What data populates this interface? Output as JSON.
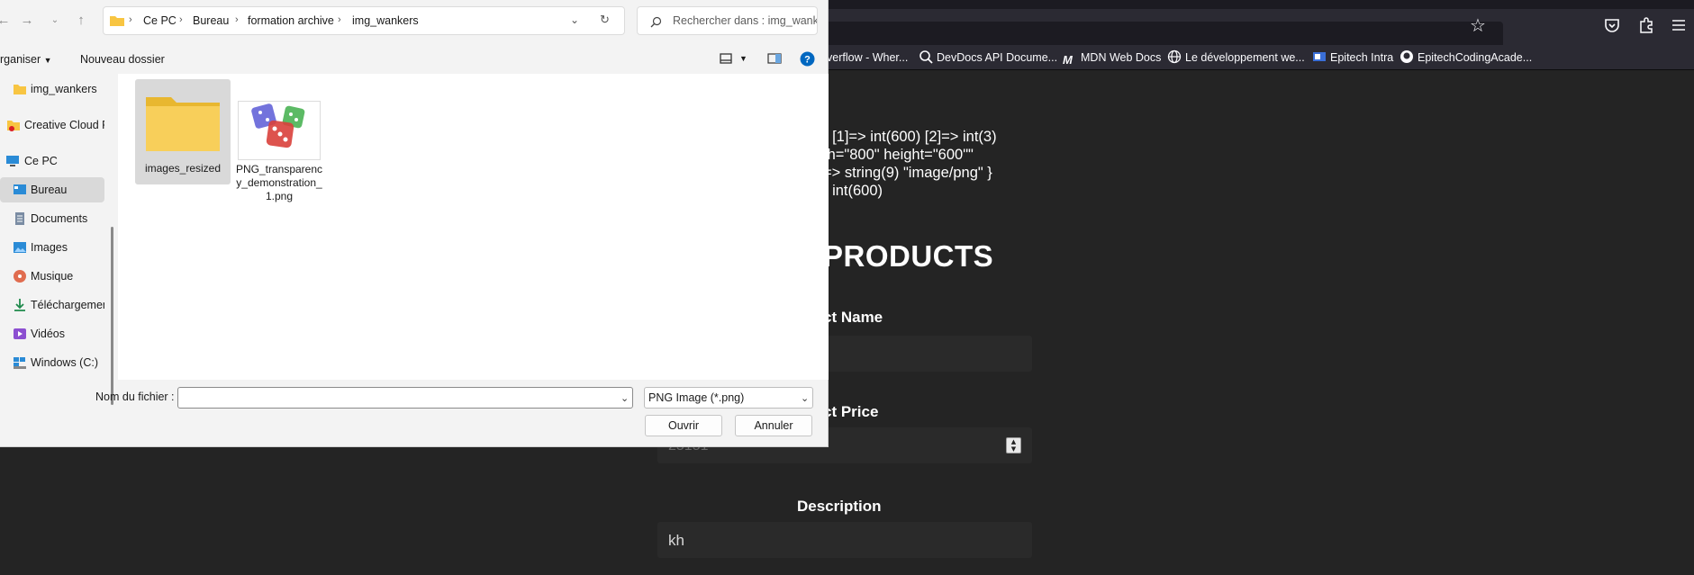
{
  "browser": {
    "bookmarks": [
      {
        "label": "verflow - Wher...",
        "icon": "stackoverflow-icon"
      },
      {
        "label": "DevDocs API Docume...",
        "icon": "devdocs-icon"
      },
      {
        "label": "MDN Web Docs",
        "icon": "mdn-icon"
      },
      {
        "label": "Le développement we...",
        "icon": "globe-icon"
      },
      {
        "label": "Epitech Intra",
        "icon": "epitech-icon"
      },
      {
        "label": "EpitechCodingAcade...",
        "icon": "github-icon"
      }
    ]
  },
  "page": {
    "dump_lines": [
      ") [1]=> int(600) [2]=> int(3)",
      "th=\"800\" height=\"600\"\"",
      "=> string(9) \"image/png\" }",
      ") int(600)"
    ],
    "heading": "PRODUCTS",
    "product_name_label": "ct Name",
    "product_price_label": "ct Price",
    "product_price_value": "25151",
    "description_label": "Description",
    "description_value": "kh"
  },
  "dialog": {
    "breadcrumb": [
      "Ce PC",
      "Bureau",
      "formation archive",
      "img_wankers"
    ],
    "search_placeholder": "Rechercher dans : img_wank...",
    "organize_label": "rganiser",
    "new_folder_label": "Nouveau dossier",
    "sidebar": [
      {
        "label": "img_wankers",
        "icon": "folder-icon"
      },
      {
        "label": "Creative Cloud F",
        "icon": "creative-cloud-icon"
      },
      {
        "label": "Ce PC",
        "icon": "computer-icon"
      },
      {
        "label": "Bureau",
        "icon": "desktop-icon",
        "selected": true
      },
      {
        "label": "Documents",
        "icon": "documents-icon"
      },
      {
        "label": "Images",
        "icon": "images-icon"
      },
      {
        "label": "Musique",
        "icon": "music-icon"
      },
      {
        "label": "Téléchargemen",
        "icon": "download-icon"
      },
      {
        "label": "Vidéos",
        "icon": "videos-icon"
      },
      {
        "label": "Windows (C:)",
        "icon": "drive-icon"
      }
    ],
    "files": [
      {
        "name": "images_resized",
        "type": "folder",
        "selected": true
      },
      {
        "name": "PNG_transparency_demonstration_1.png",
        "type": "image"
      }
    ],
    "filename_label": "Nom du fichier :",
    "filename_value": "",
    "filetype_value": "PNG Image (*.png)",
    "open_label": "Ouvrir",
    "cancel_label": "Annuler",
    "colors": {
      "accent": "#0067c0",
      "folder": "#f8c542"
    }
  }
}
